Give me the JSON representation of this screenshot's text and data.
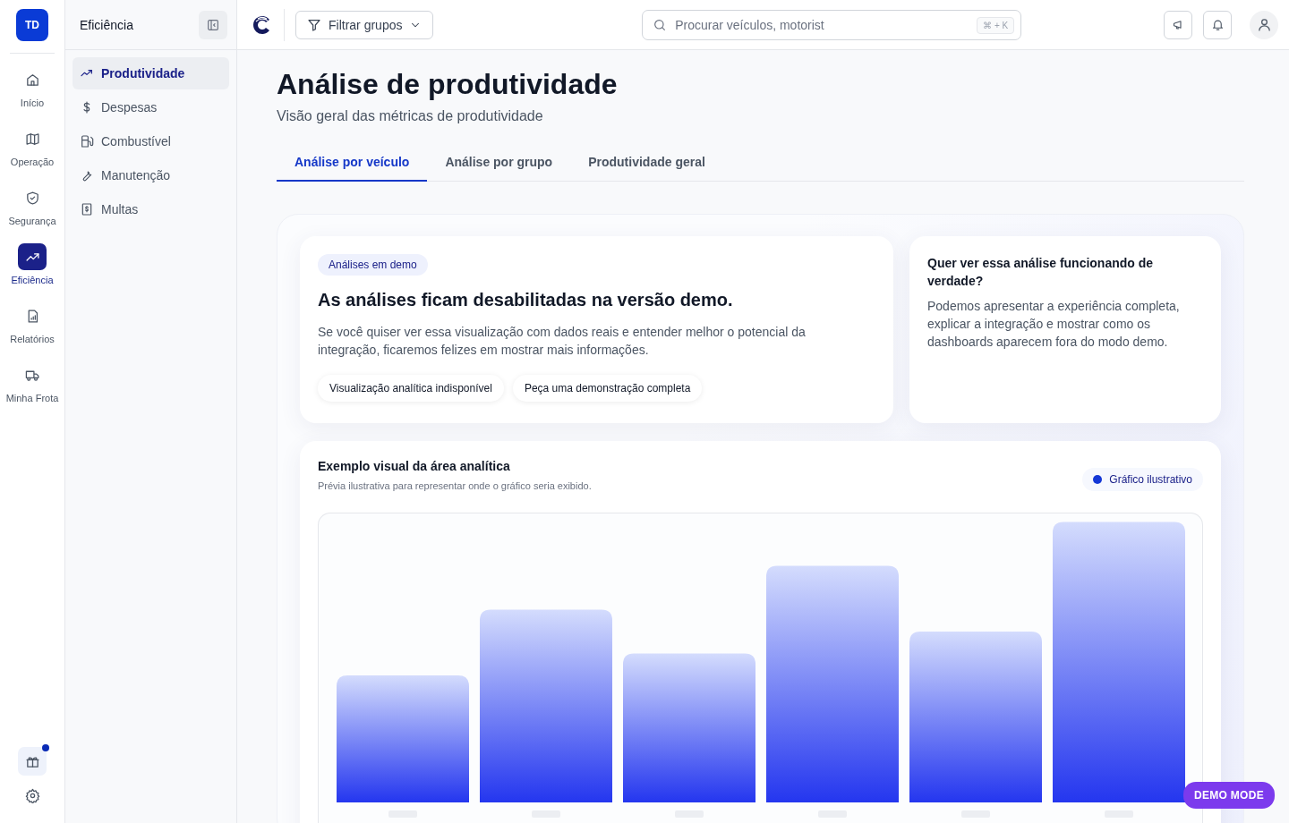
{
  "rail": {
    "avatar": "TD",
    "items": [
      {
        "label": "Início",
        "selected": false
      },
      {
        "label": "Operação",
        "selected": false
      },
      {
        "label": "Segurança",
        "selected": false
      },
      {
        "label": "Eficiência",
        "selected": true
      },
      {
        "label": "Relatórios",
        "selected": false
      },
      {
        "label": "Minha Frota",
        "selected": false
      }
    ],
    "gift_notification": true
  },
  "subnav": {
    "title": "Eficiência",
    "items": [
      {
        "label": "Produtividade",
        "selected": true
      },
      {
        "label": "Despesas",
        "selected": false
      },
      {
        "label": "Combustível",
        "selected": false
      },
      {
        "label": "Manutenção",
        "selected": false
      },
      {
        "label": "Multas",
        "selected": false
      }
    ]
  },
  "topbar": {
    "filter": "Filtrar grupos",
    "search": {
      "placeholder": "Procurar veículos, motorist",
      "shortcut": "⌘ + K"
    }
  },
  "page": {
    "title": "Análise de produtividade",
    "subtitle": "Visão geral das métricas de produtividade",
    "tabs": [
      {
        "label": "Análise por veículo",
        "selected": true
      },
      {
        "label": "Análise por grupo",
        "selected": false
      },
      {
        "label": "Produtividade geral",
        "selected": false
      }
    ]
  },
  "demo_card": {
    "badge": "Análises em demo",
    "heading": "As análises ficam desabilitadas na versão demo.",
    "text": "Se você quiser ver essa visualização com dados reais e entender melhor o potencial da integração, ficaremos felizes em mostrar mais informações.",
    "chips": [
      "Visualização analítica indisponível",
      "Peça uma demonstração completa"
    ]
  },
  "side_card": {
    "title": "Quer ver essa análise funcionando de verdade?",
    "text": "Podemos apresentar a experiência completa, explicar a integração e mostrar como os dashboards aparecem fora do modo demo."
  },
  "chart_card": {
    "title": "Exemplo visual da área analítica",
    "subtitle": "Prévia ilustrativa para representar onde o gráfico seria exibido.",
    "legend": {
      "label": "Gráfico ilustrativo",
      "color": "#1437d6"
    }
  },
  "demo_mode": "DEMO MODE"
}
